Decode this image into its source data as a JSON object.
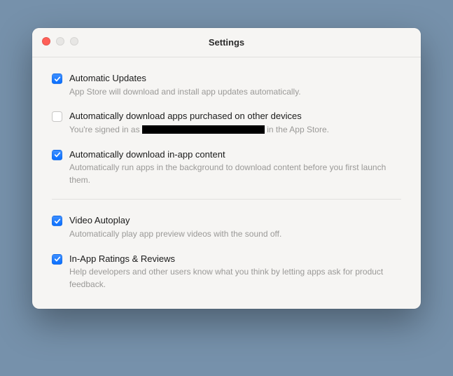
{
  "window": {
    "title": "Settings"
  },
  "settings": {
    "group1": [
      {
        "checked": true,
        "label": "Automatic Updates",
        "desc": "App Store will download and install app updates automatically.",
        "name": "automatic-updates"
      },
      {
        "checked": false,
        "label": "Automatically download apps purchased on other devices",
        "desc_prefix": "You're signed in as ",
        "desc_suffix": " in the App Store.",
        "redacted": true,
        "name": "auto-download-purchased"
      },
      {
        "checked": true,
        "label": "Automatically download in-app content",
        "desc": "Automatically run apps in the background to download content before you first launch them.",
        "name": "auto-download-inapp-content"
      }
    ],
    "group2": [
      {
        "checked": true,
        "label": "Video Autoplay",
        "desc": "Automatically play app preview videos with the sound off.",
        "name": "video-autoplay"
      },
      {
        "checked": true,
        "label": "In-App Ratings & Reviews",
        "desc": "Help developers and other users know what you think by letting apps ask for product feedback.",
        "name": "inapp-ratings-reviews"
      }
    ]
  }
}
